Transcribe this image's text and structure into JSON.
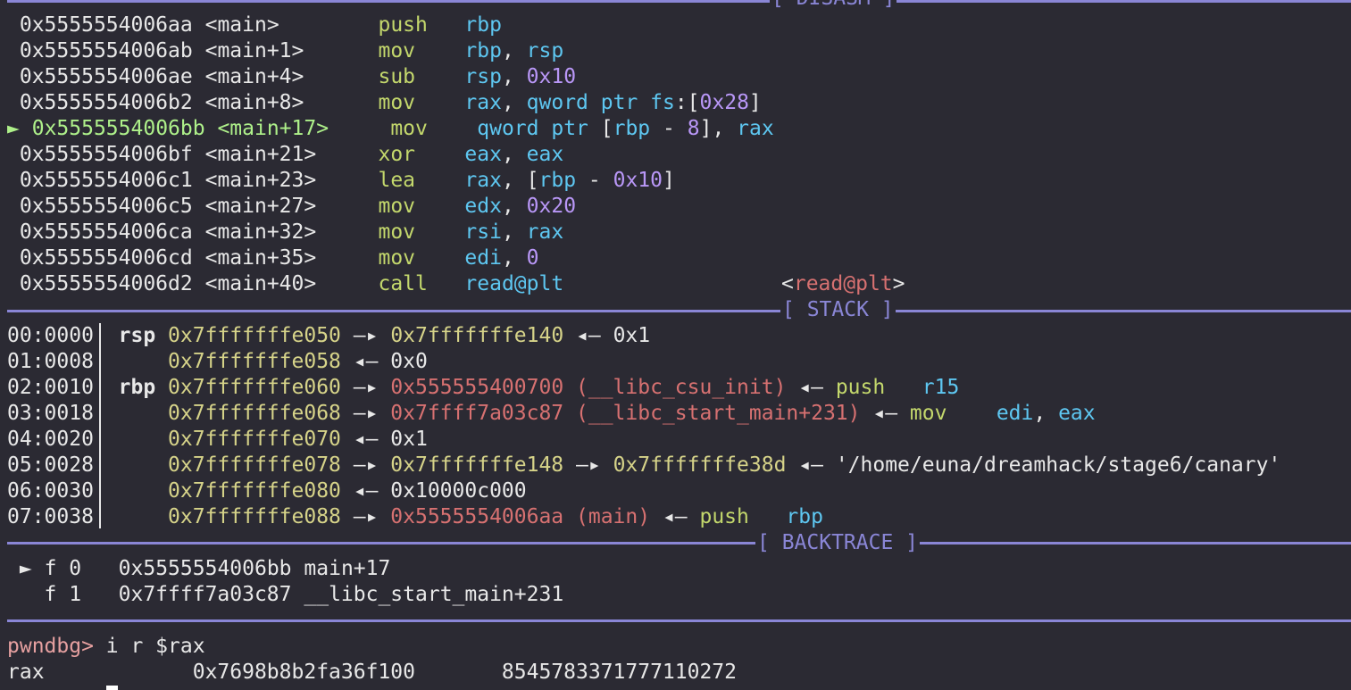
{
  "sections": {
    "disasm_title": "[ DISASM ]",
    "stack_title": "[ STACK ]",
    "backtrace_title": "[ BACKTRACE ]"
  },
  "disasm": [
    {
      "marker": "",
      "addr": "0x5555554006aa",
      "sym": "<main>",
      "mnem": "push",
      "ops": "rbp"
    },
    {
      "marker": "",
      "addr": "0x5555554006ab",
      "sym": "<main+1>",
      "mnem": "mov",
      "ops": "rbp, rsp"
    },
    {
      "marker": "",
      "addr": "0x5555554006ae",
      "sym": "<main+4>",
      "mnem": "sub",
      "ops": "rsp, 0x10"
    },
    {
      "marker": "",
      "addr": "0x5555554006b2",
      "sym": "<main+8>",
      "mnem": "mov",
      "ops": "rax, qword ptr fs:[0x28]"
    },
    {
      "marker": "►",
      "addr": "0x5555554006bb",
      "sym": "<main+17>",
      "mnem": "mov",
      "ops": "qword ptr [rbp - 8], rax"
    },
    {
      "marker": "",
      "addr": "0x5555554006bf",
      "sym": "<main+21>",
      "mnem": "xor",
      "ops": "eax, eax"
    },
    {
      "marker": "",
      "addr": "0x5555554006c1",
      "sym": "<main+23>",
      "mnem": "lea",
      "ops": "rax, [rbp - 0x10]"
    },
    {
      "marker": "",
      "addr": "0x5555554006c5",
      "sym": "<main+27>",
      "mnem": "mov",
      "ops": "edx, 0x20"
    },
    {
      "marker": "",
      "addr": "0x5555554006ca",
      "sym": "<main+32>",
      "mnem": "mov",
      "ops": "rsi, rax"
    },
    {
      "marker": "",
      "addr": "0x5555554006cd",
      "sym": "<main+35>",
      "mnem": "mov",
      "ops": "edi, 0"
    },
    {
      "marker": "",
      "addr": "0x5555554006d2",
      "sym": "<main+40>",
      "mnem": "call",
      "ops": "read@plt",
      "target": "<read@plt>"
    }
  ],
  "stack": [
    {
      "offset": "00:0000",
      "reg": "rsp",
      "addr": "0x7fffffffe050",
      "rest": "—▸ 0x7fffffffe140 ◂— 0x1"
    },
    {
      "offset": "01:0008",
      "reg": "",
      "addr": "0x7fffffffe058",
      "rest": "◂— 0x0"
    },
    {
      "offset": "02:0010",
      "reg": "rbp",
      "addr": "0x7fffffffe060",
      "rest": "—▸ 0x555555400700 (__libc_csu_init) ◂— push   r15"
    },
    {
      "offset": "03:0018",
      "reg": "",
      "addr": "0x7fffffffe068",
      "rest": "—▸ 0x7ffff7a03c87 (__libc_start_main+231) ◂— mov    edi, eax"
    },
    {
      "offset": "04:0020",
      "reg": "",
      "addr": "0x7fffffffe070",
      "rest": "◂— 0x1"
    },
    {
      "offset": "05:0028",
      "reg": "",
      "addr": "0x7fffffffe078",
      "rest": "—▸ 0x7fffffffe148 —▸ 0x7fffffffe38d ◂— '/home/euna/dreamhack/stage6/canary'"
    },
    {
      "offset": "06:0030",
      "reg": "",
      "addr": "0x7fffffffe080",
      "rest": "◂— 0x10000c000"
    },
    {
      "offset": "07:0038",
      "reg": "",
      "addr": "0x7fffffffe088",
      "rest": "—▸ 0x5555554006aa (main) ◂— push   rbp"
    }
  ],
  "backtrace": [
    {
      "marker": "►",
      "frame": "f 0",
      "addr": "0x5555554006bb",
      "sym": "main+17"
    },
    {
      "marker": "",
      "frame": "f 1",
      "addr": "0x7ffff7a03c87",
      "sym": "__libc_start_main+231"
    }
  ],
  "prompt": {
    "label": "pwndbg>",
    "command": " i r $rax"
  },
  "register_output": {
    "name": "rax",
    "hex": "0x7698b8b2fa36f100",
    "dec": "8545783371777110272"
  },
  "colors": {
    "background": "#2b2a33",
    "separator": "#8a86d6",
    "mnemonic": "#c3d76c",
    "register": "#5ec7f1",
    "immediate": "#b997f7",
    "stack_address": "#d6d389",
    "code_address": "#d77171",
    "current_line": "#aef08a",
    "prompt": "#e6a0a0"
  }
}
